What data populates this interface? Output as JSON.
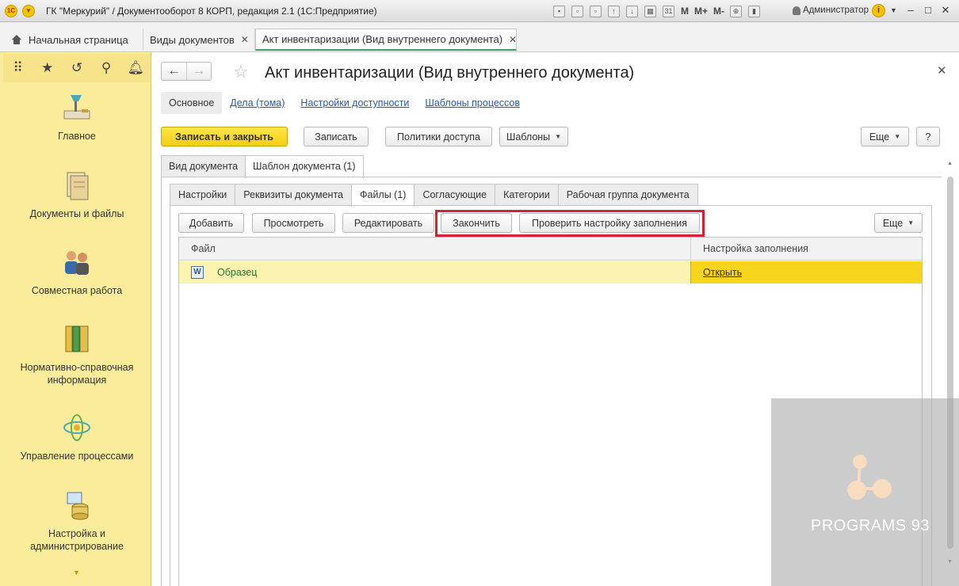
{
  "titlebar": {
    "title": "ГК \"Меркурий\" / Документооборот 8 КОРП, редакция 2.1  (1С:Предприятие)",
    "user": "Администратор",
    "m_buttons": [
      "M",
      "M+",
      "M-"
    ]
  },
  "tabs": [
    {
      "label": "Начальная страница",
      "closable": false
    },
    {
      "label": "Виды документов",
      "closable": true
    },
    {
      "label": "Акт инвентаризации (Вид внутреннего документа)",
      "closable": true,
      "active": true
    }
  ],
  "sidebar": {
    "sections": [
      {
        "label": "Главное",
        "icon": "desk-lamp-icon"
      },
      {
        "label": "Документы и файлы",
        "icon": "documents-icon"
      },
      {
        "label": "Совместная работа",
        "icon": "people-icon"
      },
      {
        "label": "Нормативно-справочная информация",
        "icon": "binders-icon"
      },
      {
        "label": "Управление процессами",
        "icon": "process-icon"
      },
      {
        "label": "Настройка и администрирование",
        "icon": "admin-icon"
      }
    ]
  },
  "form": {
    "title": "Акт инвентаризации (Вид внутреннего документа)",
    "subnav": {
      "current": "Основное",
      "links": [
        "Дела (тома)",
        "Настройки доступности",
        "Шаблоны процессов"
      ]
    },
    "toolbar": {
      "save_close": "Записать и закрыть",
      "save": "Записать",
      "access_policies": "Политики доступа",
      "templates": "Шаблоны",
      "more": "Еще",
      "help": "?"
    },
    "outer_tabs": [
      "Вид документа",
      "Шаблон документа (1)"
    ],
    "inner_tabs": [
      "Настройки",
      "Реквизиты документа",
      "Файлы (1)",
      "Согласующие",
      "Категории",
      "Рабочая группа документа"
    ],
    "files_toolbar": {
      "add": "Добавить",
      "view": "Просмотреть",
      "edit": "Редактировать",
      "finish": "Закончить",
      "check_fill": "Проверить настройку заполнения",
      "more": "Еще"
    },
    "table": {
      "headers": [
        "Файл",
        "Настройка заполнения"
      ],
      "rows": [
        {
          "file": "Образец",
          "fill_setting": "Открыть"
        }
      ]
    }
  },
  "watermark": {
    "text": "PROGRAMS 93"
  }
}
